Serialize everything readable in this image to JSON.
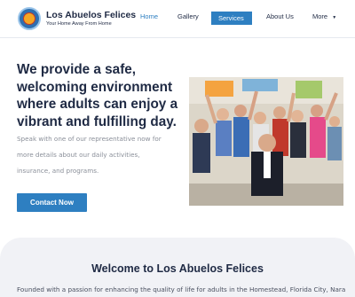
{
  "brand": {
    "name": "Los Abuelos Felices",
    "tagline": "Your Home Away From Home",
    "logo_icon": "sun-logo-icon"
  },
  "nav": {
    "home": "Home",
    "gallery": "Gallery",
    "services": "Services",
    "about": "About Us",
    "more": "More",
    "caret_icon": "chevron-down-icon",
    "active": "Home",
    "highlighted": "Services"
  },
  "hero": {
    "title": "We provide a safe, welcoming environment where adults can enjoy a vibrant and fulfilling day.",
    "subtitle": "Speak with one of our representative now for more details about our daily activities, insurance, and programs.",
    "button": "Contact Now"
  },
  "welcome": {
    "title": "Welcome to Los Abuelos Felices",
    "text": "Founded with a passion for enhancing the quality of life for adults in the Homestead, Florida City, Naranja, and"
  },
  "colors": {
    "accent": "#2e7fc1",
    "text_dark": "#1f2a44",
    "muted": "#8a8f99",
    "section_bg": "#f1f2f6"
  }
}
